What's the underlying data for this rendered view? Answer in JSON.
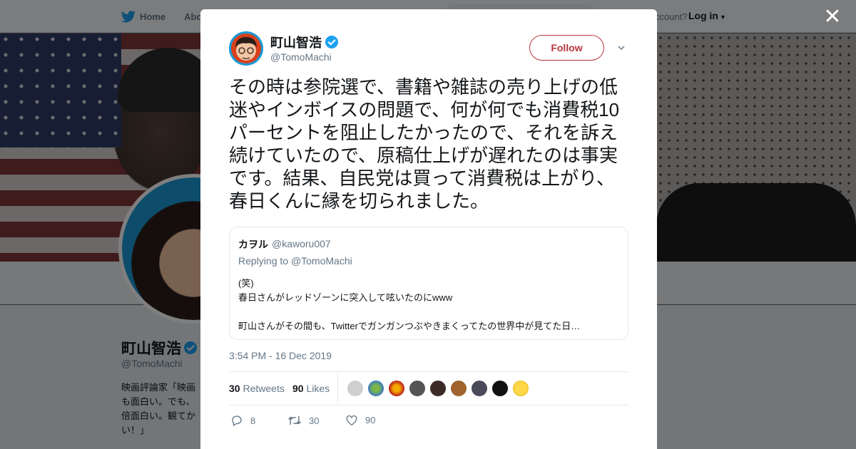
{
  "topbar": {
    "home_label": "Home",
    "about_label": "Abo",
    "account_text": "ccount?",
    "login_label": "Log in"
  },
  "profile": {
    "name": "町山智浩",
    "handle": "@TomoMachi",
    "bio": "映画評論家「映画 も面白い。でも、 倍面白い。観てか い！」"
  },
  "tweet": {
    "author_name": "町山智浩",
    "author_handle": "@TomoMachi",
    "follow_label": "Follow",
    "text": "その時は参院選で、書籍や雑誌の売り上げの低迷やインボイスの問題で、何が何でも消費税10パーセントを阻止したかったので、それを訴え続けていたので、原稿仕上げが遅れたのは事実です。結果、自民党は買って消費税は上がり、春日くんに縁を切られました。",
    "quoted": {
      "name": "カヲル",
      "handle": "@kaworu007",
      "replying_prefix": "Replying to",
      "replying_to": "@TomoMachi",
      "line1": "(笑)",
      "line2": "春日さんがレッドゾーンに突入して呟いたのにwww",
      "line3": "町山さんがその間も、Twitterでガンガンつぶやきまくってたの世界中が見てた日…"
    },
    "timestamp": "3:54 PM - 16 Dec 2019",
    "retweets_count": "30",
    "retweets_label": "Retweets",
    "likes_count": "90",
    "likes_label": "Likes",
    "actions": {
      "replies": "8",
      "retweets": "30",
      "likes": "90"
    }
  },
  "colors": {
    "follow_accent": "#b8343d",
    "verified": "#1da1f2",
    "brand_blue": "#1da1f2",
    "muted_text": "#657786"
  },
  "icons": [
    "twitter-bird-icon",
    "verified-badge-icon",
    "chevron-down-icon",
    "close-icon",
    "reply-icon",
    "retweet-icon",
    "like-icon"
  ]
}
